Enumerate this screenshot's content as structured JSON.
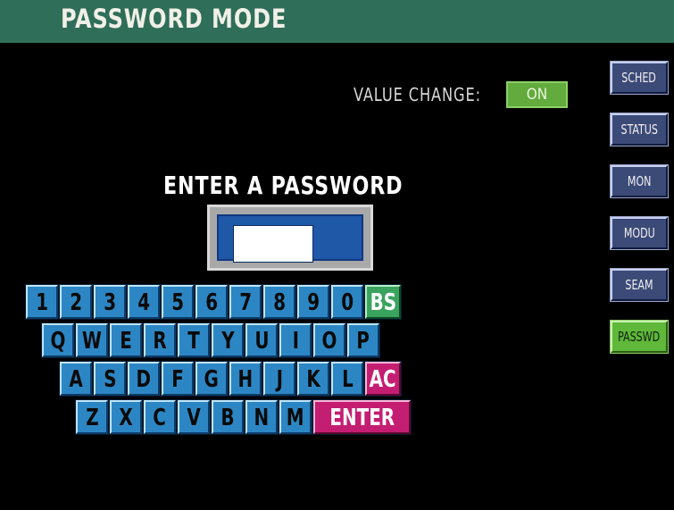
{
  "header": {
    "title": "PASSWORD MODE"
  },
  "value_change": {
    "label": "VALUE CHANGE:",
    "state": "ON"
  },
  "prompt": "ENTER A PASSWORD",
  "password_field": {
    "value": ""
  },
  "keyboard": {
    "row1": [
      "1",
      "2",
      "3",
      "4",
      "5",
      "6",
      "7",
      "8",
      "9",
      "0"
    ],
    "row1_extra": "BS",
    "row2": [
      "Q",
      "W",
      "E",
      "R",
      "T",
      "Y",
      "U",
      "I",
      "O",
      "P"
    ],
    "row3": [
      "A",
      "S",
      "D",
      "F",
      "G",
      "H",
      "J",
      "K",
      "L"
    ],
    "row3_extra": "AC",
    "row4": [
      "Z",
      "X",
      "C",
      "V",
      "B",
      "N",
      "M"
    ],
    "row4_extra": "ENTER"
  },
  "sidebar": {
    "items": [
      {
        "label": "SCHED"
      },
      {
        "label": "STATUS"
      },
      {
        "label": "MON"
      },
      {
        "label": "MODU"
      },
      {
        "label": "SEAM"
      },
      {
        "label": "PASSWD",
        "active": true
      }
    ]
  },
  "colors": {
    "title_bar": "#2f6e58",
    "key_blue": "#2d86c4",
    "key_green": "#3aa35e",
    "key_pink": "#c41e72",
    "active_tab": "#5fb83a",
    "side_button": "#3c4a78"
  }
}
